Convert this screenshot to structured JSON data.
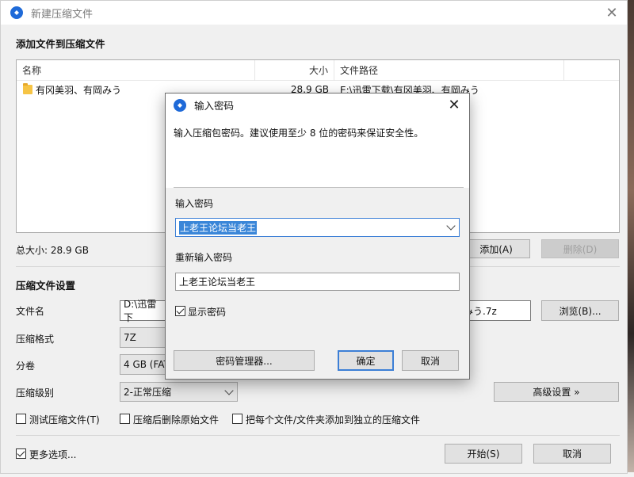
{
  "main_window": {
    "title": "新建压缩文件",
    "add_files_heading": "添加文件到压缩文件",
    "columns": {
      "name": "名称",
      "size": "大小",
      "path": "文件路径"
    },
    "files": [
      {
        "name": "有冈美羽、有岡みう",
        "size": "28.9 GB",
        "path": "E:\\迅雷下载\\有冈美羽、有岡みう"
      }
    ],
    "total_size": "总大小: 28.9 GB",
    "add_button": "添加(A)",
    "delete_button": "删除(D)",
    "settings_heading": "压缩文件设置",
    "filename_label": "文件名",
    "filename_value_left": "D:\\迅雷下",
    "filename_value_right": "みう.7z",
    "browse_button": "浏览(B)...",
    "format_label": "压缩格式",
    "format_value": "7Z",
    "split_label": "分卷",
    "split_value": "4 GB (FAT",
    "level_label": "压缩级别",
    "level_value": "2-正常压缩",
    "advanced_button": "高级设置 »",
    "test_checkbox": "测试压缩文件(T)",
    "delete_source_checkbox": "压缩后删除原始文件",
    "separate_checkbox": "把每个文件/文件夹添加到独立的压缩文件",
    "more_options_checkbox": "更多选项...",
    "start_button": "开始(S)",
    "cancel_button": "取消"
  },
  "password_dialog": {
    "title": "输入密码",
    "hint": "输入压缩包密码。建议使用至少 8 位的密码来保证安全性。",
    "password_label": "输入密码",
    "password_value": "上老王论坛当老王",
    "reenter_label": "重新输入密码",
    "reenter_value": "上老王论坛当老王",
    "show_password_label": "显示密码",
    "manager_button": "密码管理器...",
    "ok_button": "确定",
    "cancel_button": "取消"
  }
}
